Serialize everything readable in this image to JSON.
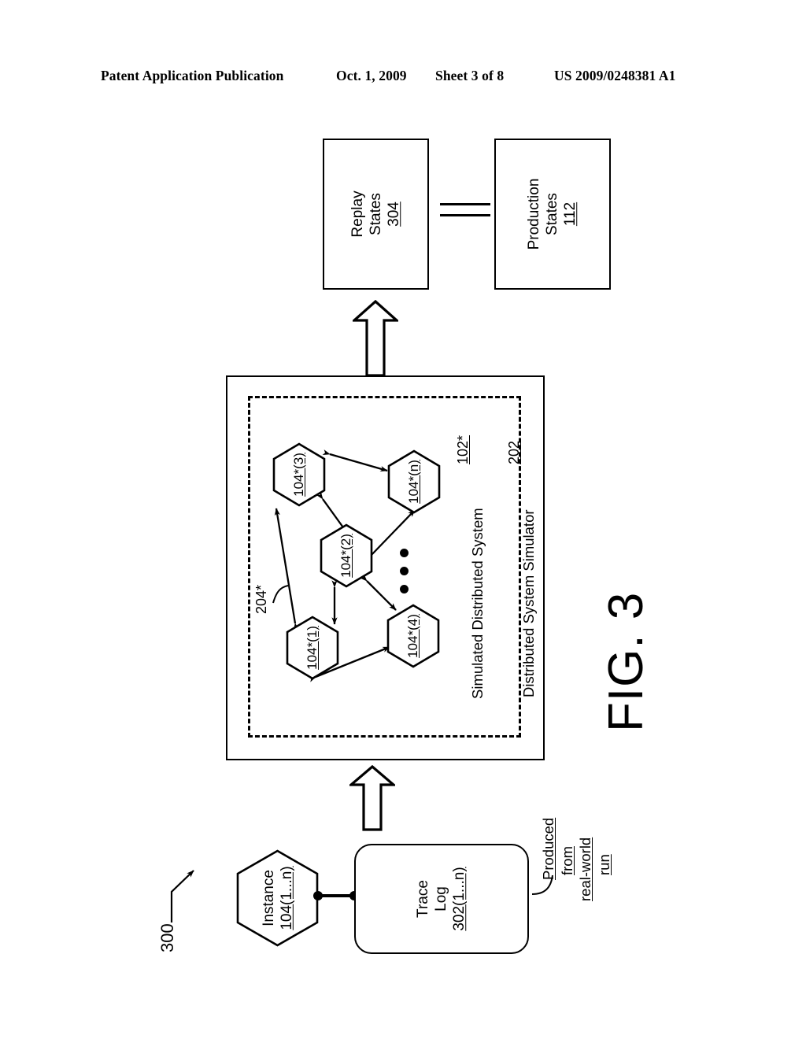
{
  "header": {
    "publication": "Patent Application Publication",
    "date": "Oct. 1, 2009",
    "sheet": "Sheet 3 of 8",
    "patent_number": "US 2009/0248381 A1"
  },
  "figure": {
    "label": "FIG. 3",
    "reference_numeral": "300"
  },
  "state_boxes": {
    "replay": {
      "line1": "Replay",
      "line2": "States",
      "numeral": "304"
    },
    "production": {
      "line1": "Production",
      "line2": "States",
      "numeral": "112"
    },
    "relation": "="
  },
  "simulator": {
    "outer_label": "Distributed System Simulator",
    "outer_numeral": "202",
    "inner_label": "Simulated Distributed System",
    "inner_numeral": "102*",
    "link_numeral": "204*",
    "ellipsis": "•••",
    "nodes": [
      {
        "id": "hex-3",
        "label": "104*(3)"
      },
      {
        "id": "hex-n",
        "label": "104*(n)"
      },
      {
        "id": "hex-2",
        "label": "104*(2)"
      },
      {
        "id": "hex-4",
        "label": "104*(4)"
      },
      {
        "id": "hex-1",
        "label": "104*(1)"
      }
    ]
  },
  "source": {
    "instance": {
      "line1": "Instance",
      "numeral": "104(1...n)"
    },
    "trace_log": {
      "line1": "Trace",
      "line2": "Log",
      "numeral": "302(1...n)"
    },
    "annotation": {
      "line1": "Produced",
      "line2": "from",
      "line3": "real-world",
      "line4": "run"
    }
  },
  "colors": {
    "ink": "#000000",
    "paper": "#ffffff"
  }
}
